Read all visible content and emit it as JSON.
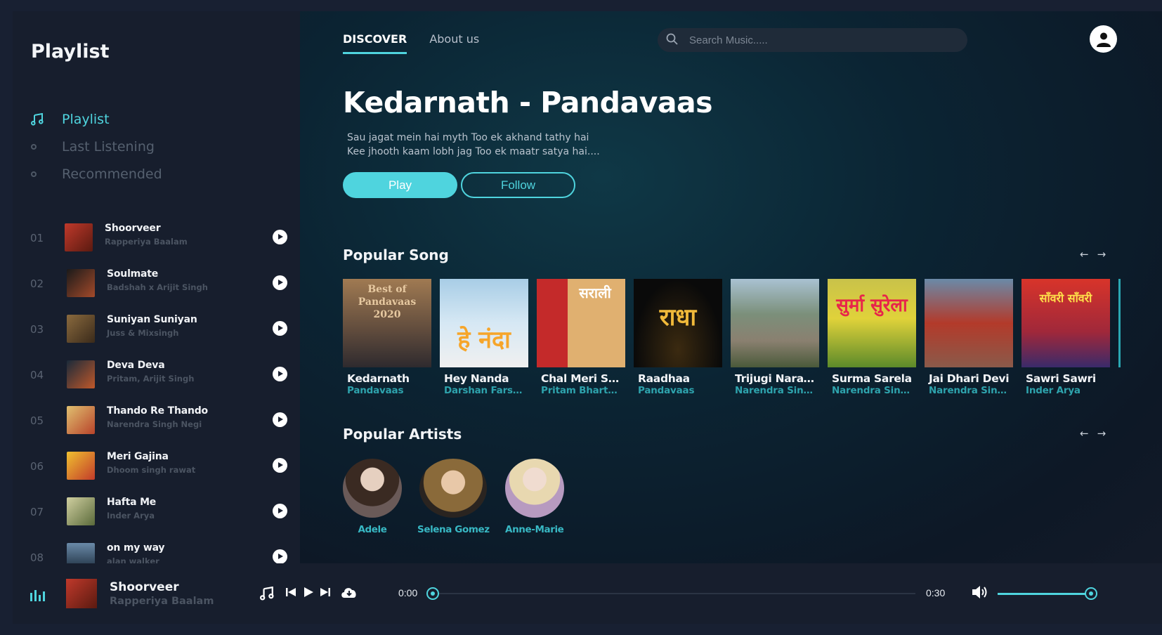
{
  "sidebar": {
    "title": "Playlist",
    "nav": [
      {
        "label": "Playlist",
        "active": true,
        "icon": "music-note-icon"
      },
      {
        "label": "Last Listening",
        "active": false,
        "icon": "circle-icon"
      },
      {
        "label": "Recommended",
        "active": false,
        "icon": "circle-icon"
      }
    ],
    "tracks": [
      {
        "num": "01",
        "title": "Shoorveer",
        "artist": "Rapperiya Baalam",
        "color": "#8b2a1e"
      },
      {
        "num": "02",
        "title": "Soulmate",
        "artist": "Badshah x Arijit Singh",
        "color": "#3b2a26"
      },
      {
        "num": "03",
        "title": "Suniyan Suniyan",
        "artist": "Juss & Mixsingh",
        "color": "#6b4b2e"
      },
      {
        "num": "04",
        "title": "Deva Deva",
        "artist": "Pritam, Arijit Singh",
        "color": "#7a3a1a"
      },
      {
        "num": "05",
        "title": "Thando Re Thando",
        "artist": "Narendra Singh Negi",
        "color": "#b8432a"
      },
      {
        "num": "06",
        "title": "Meri Gajina",
        "artist": "Dhoom singh rawat",
        "color": "#c23b2a"
      },
      {
        "num": "07",
        "title": "Hafta Me",
        "artist": "Inder Arya",
        "color": "#8c8a5a"
      },
      {
        "num": "08",
        "title": "on my way",
        "artist": "alan walker",
        "color": "#2c4a62"
      }
    ]
  },
  "header": {
    "tabs": [
      {
        "label": "DISCOVER",
        "active": true
      },
      {
        "label": "About us",
        "active": false
      }
    ],
    "search_placeholder": "Search Music....."
  },
  "hero": {
    "title": "Kedarnath - Pandavaas",
    "line1": "Sau jagat mein hai myth Too ek akhand tathy hai",
    "line2": "Kee jhooth kaam lobh jag Too ek maatr satya hai....",
    "play_label": "Play",
    "follow_label": "Follow"
  },
  "popular_songs": {
    "title": "Popular Song",
    "items": [
      {
        "title": "Kedarnath",
        "artist": "Pandavaas",
        "bg": "#7a5a3e",
        "bg2": "#3f3a3a",
        "label": "Best of Pandavaas 2020",
        "labelColor": "#e7c9a1"
      },
      {
        "title": "Hey Nanda",
        "artist": "Darshan Farswan",
        "bg": "#b7d7ee",
        "bg2": "#f0a044",
        "label": "हे नंदा",
        "labelColor": "#f6a52a"
      },
      {
        "title": "Chal Meri Sarita",
        "artist": "Pritam Bhartwan",
        "bg": "#c42a2a",
        "bg2": "#6f9a3e",
        "label": "सराली",
        "labelColor": "#ffffff"
      },
      {
        "title": "Raadhaa",
        "artist": "Pandavaas",
        "bg": "#0a0a0a",
        "bg2": "#3b2a10",
        "label": "राधा",
        "labelColor": "#f0b93a"
      },
      {
        "title": "Trijugi Narayan",
        "artist": "Narendra Singh Negi",
        "bg": "#9fb8c8",
        "bg2": "#5a6a3c",
        "label": "",
        "labelColor": "#ffffff"
      },
      {
        "title": "Surma Sarela",
        "artist": "Narendra Singh Negi",
        "bg": "#d2c22a",
        "bg2": "#5c8a2a",
        "label": "सुर्मा सुरेला",
        "labelColor": "#e8254a"
      },
      {
        "title": "Jai Dhari Devi",
        "artist": "Narendra Singh Negi",
        "bg": "#b33a2a",
        "bg2": "#6a4a8a",
        "label": "",
        "labelColor": "#ffffff"
      },
      {
        "title": "Sawri Sawri",
        "artist": "Inder Arya",
        "bg": "#c8322a",
        "bg2": "#3a2a6a",
        "label": "साँवरी साँवरी",
        "labelColor": "#ffe14a"
      }
    ]
  },
  "popular_artists": {
    "title": "Popular Artists",
    "items": [
      {
        "name": "Adele",
        "bg": "#7a6a66"
      },
      {
        "name": "Selena Gomez",
        "bg": "#8a6a4a"
      },
      {
        "name": "Anne-Marie",
        "bg": "#a88fb0"
      }
    ]
  },
  "player": {
    "title": "Shoorveer",
    "artist": "Rapperiya Baalam",
    "current_time": "0:00",
    "duration": "0:30",
    "progress": 0.0,
    "volume": 0.9
  },
  "colors": {
    "accent": "#4fd4de",
    "sidebar_bg": "#171e2d",
    "muted": "#4b5462"
  }
}
